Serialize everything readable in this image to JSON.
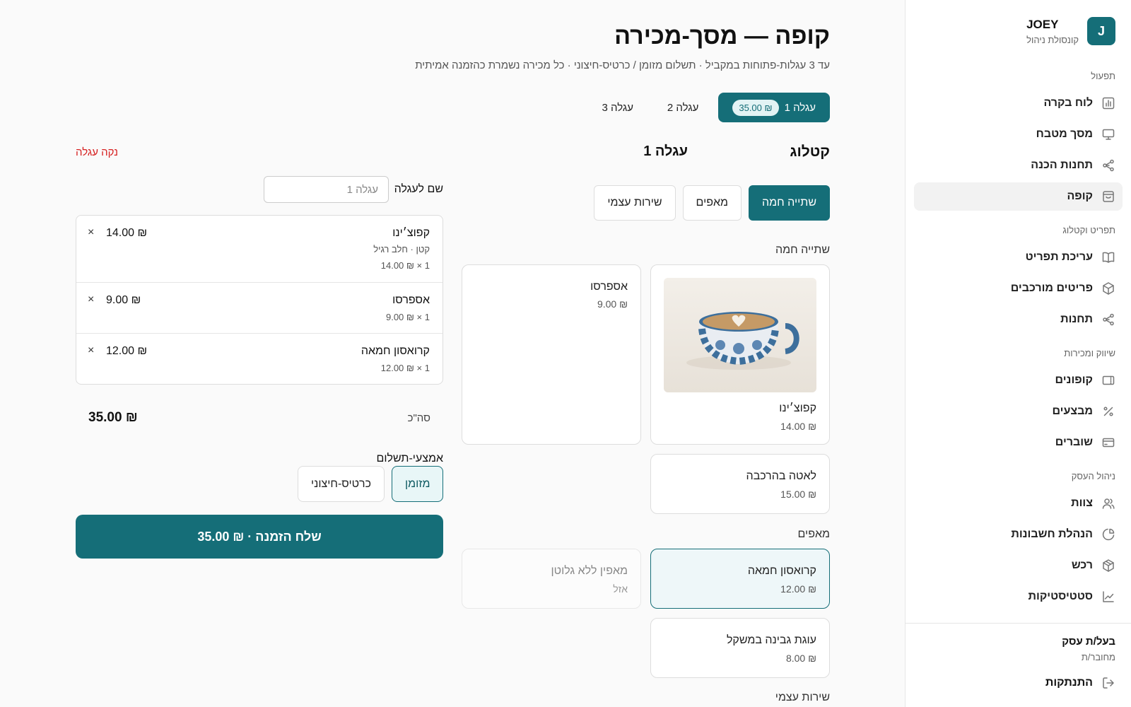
{
  "brand": {
    "initial": "J",
    "name": "JOEY",
    "subtitle": "קונסולת ניהול"
  },
  "sidebar": {
    "sections": [
      {
        "title": "תפעול",
        "items": [
          {
            "label": "לוח בקרה",
            "icon": "chart-icon"
          },
          {
            "label": "מסך מטבח",
            "icon": "monitor-icon"
          },
          {
            "label": "תחנות הכנה",
            "icon": "share-icon"
          },
          {
            "label": "קופה",
            "icon": "register-icon",
            "active": true
          }
        ]
      },
      {
        "title": "תפריט וקטלוג",
        "items": [
          {
            "label": "עריכת תפריט",
            "icon": "book-icon"
          },
          {
            "label": "פריטים מורכבים",
            "icon": "box-icon"
          },
          {
            "label": "תחנות",
            "icon": "share-icon"
          }
        ]
      },
      {
        "title": "שיווק ומכירות",
        "items": [
          {
            "label": "קופונים",
            "icon": "ticket-icon"
          },
          {
            "label": "מבצעים",
            "icon": "percent-icon"
          },
          {
            "label": "שוברים",
            "icon": "card-icon"
          }
        ]
      },
      {
        "title": "ניהול העסק",
        "items": [
          {
            "label": "צוות",
            "icon": "users-icon"
          },
          {
            "label": "הנהלת חשבונות",
            "icon": "pie-icon"
          },
          {
            "label": "רכש",
            "icon": "package-icon"
          },
          {
            "label": "סטטיסטיקות",
            "icon": "trend-icon"
          }
        ]
      }
    ],
    "user": {
      "role": "בעל/ת עסק",
      "status": "מחובר/ת"
    },
    "logout": "התנתקות"
  },
  "header": {
    "title": "קופה — מסך-מכירה",
    "subtitle": "עד 3 עגלות-פתוחות במקביל · תשלום מזומן / כרטיס-חיצוני · כל מכירה נשמרת כהזמנה אמיתית"
  },
  "tabs": [
    {
      "label": "עגלה 1",
      "badge": "₪ 35.00",
      "active": true
    },
    {
      "label": "עגלה 2"
    },
    {
      "label": "עגלה 3"
    }
  ],
  "catalog": {
    "title": "קטלוג",
    "categories": [
      "שתייה חמה",
      "מאפים",
      "שירות עצמי"
    ],
    "sections": {
      "hot": "שתייה חמה",
      "pastry": "מאפים",
      "self": "שירות עצמי"
    },
    "products": {
      "cappuccino": {
        "name": "קפוצ׳ינו",
        "price": "₪ 14.00"
      },
      "espresso": {
        "name": "אספרסו",
        "price": "₪ 9.00"
      },
      "latte": {
        "name": "לאטה בהרכבה",
        "price": "₪ 15.00"
      },
      "croissant": {
        "name": "קרואסון חמאה",
        "price": "₪ 12.00"
      },
      "glutenfree": {
        "name": "מאפין ללא גלוטן",
        "price": "אזל"
      },
      "cheesecake": {
        "name": "עוגת גבינה במשקל",
        "price": "₪ 8.00"
      }
    }
  },
  "cart": {
    "title": "עגלה 1",
    "clear_label": "נקה עגלה",
    "name_label": "שם לעגלה",
    "name_placeholder": "עגלה 1",
    "lines": [
      {
        "name": "קפוצ׳ינו",
        "options": "קטן · חלב רגיל",
        "qty": "1 × ₪ 14.00",
        "price": "₪ 14.00",
        "remove": "×"
      },
      {
        "name": "אספרסו",
        "qty": "1 × ₪ 9.00",
        "price": "₪ 9.00",
        "remove": "×"
      },
      {
        "name": "קרואסון חמאה",
        "qty": "1 × ₪ 12.00",
        "price": "₪ 12.00",
        "remove": "×"
      }
    ],
    "total_label": "סה\"כ",
    "total_value": "₪ 35.00",
    "payment_label": "אמצעי-תשלום",
    "payment_options": [
      {
        "label": "מזומן",
        "active": true
      },
      {
        "label": "כרטיס-חיצוני"
      }
    ],
    "submit_label": "שלח הזמנה · ₪ 35.00"
  },
  "colors": {
    "accent": "#156e78",
    "danger": "#d61f1f"
  }
}
